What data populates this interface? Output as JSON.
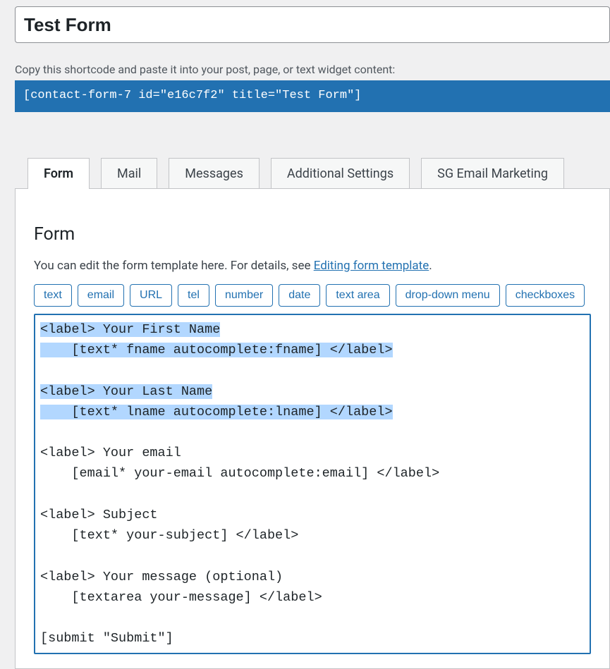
{
  "title_value": "Test Form",
  "shortcode_help": "Copy this shortcode and paste it into your post, page, or text widget content:",
  "shortcode_text": "[contact-form-7 id=\"e16c7f2\" title=\"Test Form\"]",
  "tabs": [
    {
      "id": "form",
      "label": "Form",
      "active": true
    },
    {
      "id": "mail",
      "label": "Mail",
      "active": false
    },
    {
      "id": "messages",
      "label": "Messages",
      "active": false
    },
    {
      "id": "additional",
      "label": "Additional Settings",
      "active": false
    },
    {
      "id": "sg",
      "label": "SG Email Marketing",
      "active": false
    }
  ],
  "panel_title": "Form",
  "panel_desc_prefix": "You can edit the form template here. For details, see ",
  "panel_desc_link": "Editing form template",
  "panel_desc_suffix": ".",
  "tag_buttons": [
    "text",
    "email",
    "URL",
    "tel",
    "number",
    "date",
    "text area",
    "drop-down menu",
    "checkboxes"
  ],
  "editor": {
    "line1": "<label> Your First Name",
    "line2": "    [text* fname autocomplete:fname] </label>",
    "line3": "",
    "line4": "<label> Your Last Name",
    "line5": "    [text* lname autocomplete:lname] </label>",
    "line6": "",
    "line7": "<label> Your email",
    "line8": "    [email* your-email autocomplete:email] </label>",
    "line9": "",
    "line10": "<label> Subject",
    "line11": "    [text* your-subject] </label>",
    "line12": "",
    "line13": "<label> Your message (optional)",
    "line14": "    [textarea your-message] </label>",
    "line15": "",
    "line16": "[submit \"Submit\"]"
  }
}
